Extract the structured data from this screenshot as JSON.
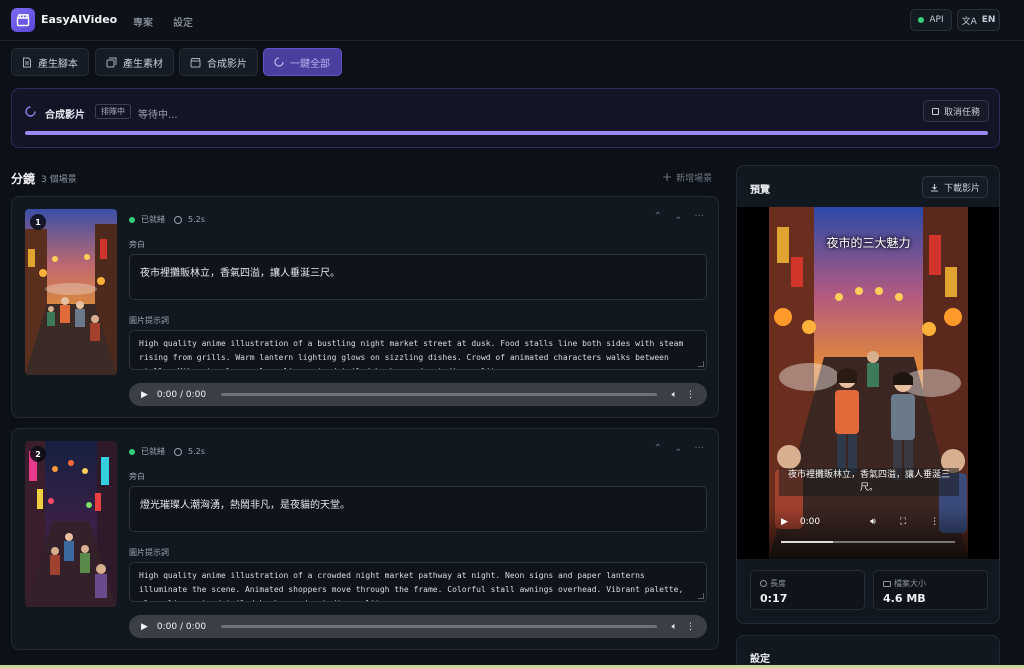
{
  "app": {
    "name": "EasyAIVideo"
  },
  "nav": {
    "projects": "專案",
    "settings": "設定"
  },
  "top_right": {
    "api_label": "API",
    "lang_label": "EN"
  },
  "actions": {
    "script": "產生腳本",
    "assets": "產生素材",
    "compose": "合成影片",
    "all": "一鍵全部"
  },
  "progress": {
    "title": "合成影片",
    "badge": "排隊中",
    "status": "等待中...",
    "cancel": "取消任務",
    "value": 1.0
  },
  "storyboard": {
    "title": "分鏡",
    "count": "3 個場景",
    "add_scene": "新增場景"
  },
  "scenes": [
    {
      "number": "1",
      "status": "已就緒",
      "duration": "5.2s",
      "narration_label": "旁白",
      "narration": "夜市裡攤販林立，香氣四溢，讓人垂涎三尺。",
      "prompt_label": "圖片提示詞",
      "prompt": "High quality anime illustration of a bustling night market street at dusk. Food stalls line both sides with steam rising from grills. Warm lantern lighting glows on sizzling dishes. Crowd of animated characters walks between stalls. Vibrant colors, clean line art, detailed background, studio quality.",
      "audio_time": "0:00 / 0:00"
    },
    {
      "number": "2",
      "status": "已就緒",
      "duration": "5.2s",
      "narration_label": "旁白",
      "narration": "燈光璀璨人潮洶湧，熱鬧非凡，是夜貓的天堂。",
      "prompt_label": "圖片提示詞",
      "prompt": "High quality anime illustration of a crowded night market pathway at night. Neon signs and paper lanterns illuminate the scene. Animated shoppers move through the frame. Colorful stall awnings overhead. Vibrant palette, clean line art, detailed background, studio quality.",
      "audio_time": "0:00 / 0:00"
    }
  ],
  "preview": {
    "title": "預覽",
    "download": "下載影片",
    "video_title": "夜市的三大魅力",
    "video_subtitle": "夜市裡攤販林立，香氣四溢，讓人垂涎三尺。",
    "video_time": "0:00",
    "length_label": "長度",
    "length_value": "0:17",
    "size_label": "檔案大小",
    "size_value": "4.6 MB"
  },
  "settings_panel": {
    "title": "設定"
  },
  "colors": {
    "accent": "#9b86f2",
    "ready": "#34d07a",
    "background": "#0c1117"
  }
}
